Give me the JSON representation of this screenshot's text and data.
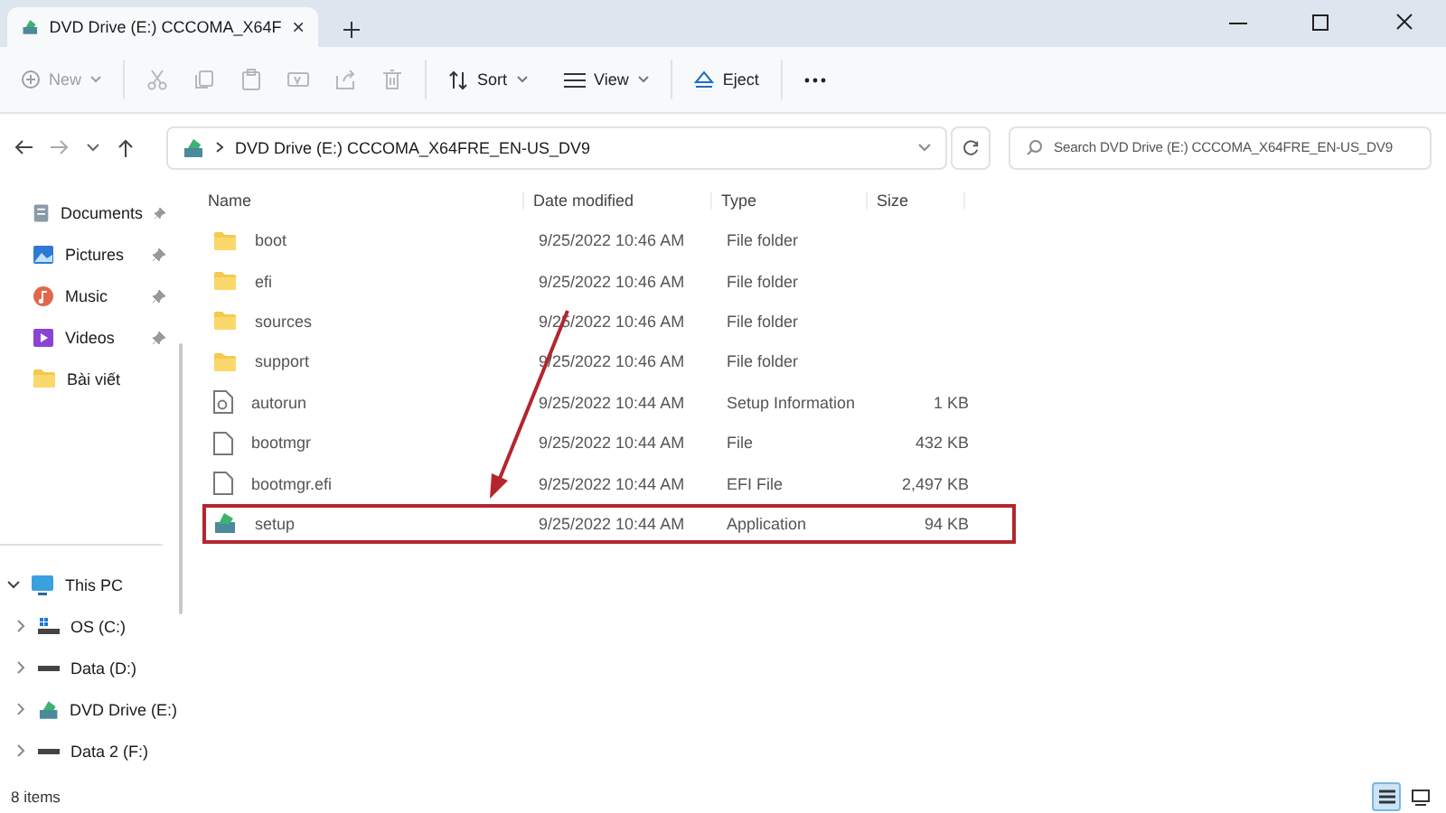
{
  "window": {
    "tab_title": "DVD Drive (E:) CCCOMA_X64F",
    "tab_selected": true
  },
  "toolbar": {
    "new": {
      "label": "New",
      "disabled": true
    },
    "edit_disabled": true,
    "sort": {
      "label": "Sort"
    },
    "view": {
      "label": "View"
    },
    "eject": {
      "label": "Eject"
    }
  },
  "address": {
    "path": "DVD Drive (E:) CCCOMA_X64FRE_EN-US_DV9",
    "search_placeholder": "Search DVD Drive (E:) CCCOMA_X64FRE_EN-US_DV9"
  },
  "sidebar": {
    "quick_access": [
      {
        "label": "Documents",
        "kind": "documents",
        "pinned": true
      },
      {
        "label": "Pictures",
        "kind": "pictures",
        "pinned": true
      },
      {
        "label": "Music",
        "kind": "music",
        "pinned": true
      },
      {
        "label": "Videos",
        "kind": "videos",
        "pinned": true
      },
      {
        "label": "Bài viết",
        "kind": "folder",
        "pinned": false
      }
    ],
    "this_pc": {
      "label": "This PC",
      "expanded": true,
      "children": [
        {
          "label": "OS (C:)",
          "kind": "os-drive",
          "expanded": false
        },
        {
          "label": "Data (D:)",
          "kind": "drive",
          "expanded": false
        },
        {
          "label": "DVD Drive (E:)",
          "kind": "dvd",
          "expanded": false
        },
        {
          "label": "Data 2 (F:)",
          "kind": "drive",
          "expanded": false
        }
      ]
    }
  },
  "table": {
    "columns": [
      "Name",
      "Date modified",
      "Type",
      "Size"
    ],
    "rows": [
      {
        "name": "boot",
        "date": "9/25/2022 10:46 AM",
        "type": "File folder",
        "kind": "folder",
        "highlighted": false
      },
      {
        "name": "efi",
        "date": "9/25/2022 10:46 AM",
        "type": "File folder",
        "kind": "folder",
        "highlighted": false
      },
      {
        "name": "sources",
        "date": "9/25/2022 10:46 AM",
        "type": "File folder",
        "kind": "folder",
        "highlighted": false
      },
      {
        "name": "support",
        "date": "9/25/2022 10:46 AM",
        "type": "File folder",
        "kind": "folder",
        "highlighted": false
      },
      {
        "name": "autorun",
        "date": "9/25/2022 10:44 AM",
        "type": "Setup Information",
        "size": "1 KB",
        "kind": "setup-info",
        "highlighted": false
      },
      {
        "name": "bootmgr",
        "date": "9/25/2022 10:44 AM",
        "type": "File",
        "size": "432 KB",
        "kind": "file",
        "highlighted": false
      },
      {
        "name": "bootmgr.efi",
        "date": "9/25/2022 10:44 AM",
        "type": "EFI File",
        "size": "2,497 KB",
        "kind": "file",
        "highlighted": false
      },
      {
        "name": "setup",
        "date": "9/25/2022 10:44 AM",
        "type": "Application",
        "size": "94 KB",
        "kind": "app",
        "highlighted": true
      }
    ]
  },
  "status_bar": {
    "count": "8 items",
    "views": [
      {
        "kind": "details",
        "selected": true
      },
      {
        "kind": "tiles",
        "selected": false
      }
    ]
  }
}
